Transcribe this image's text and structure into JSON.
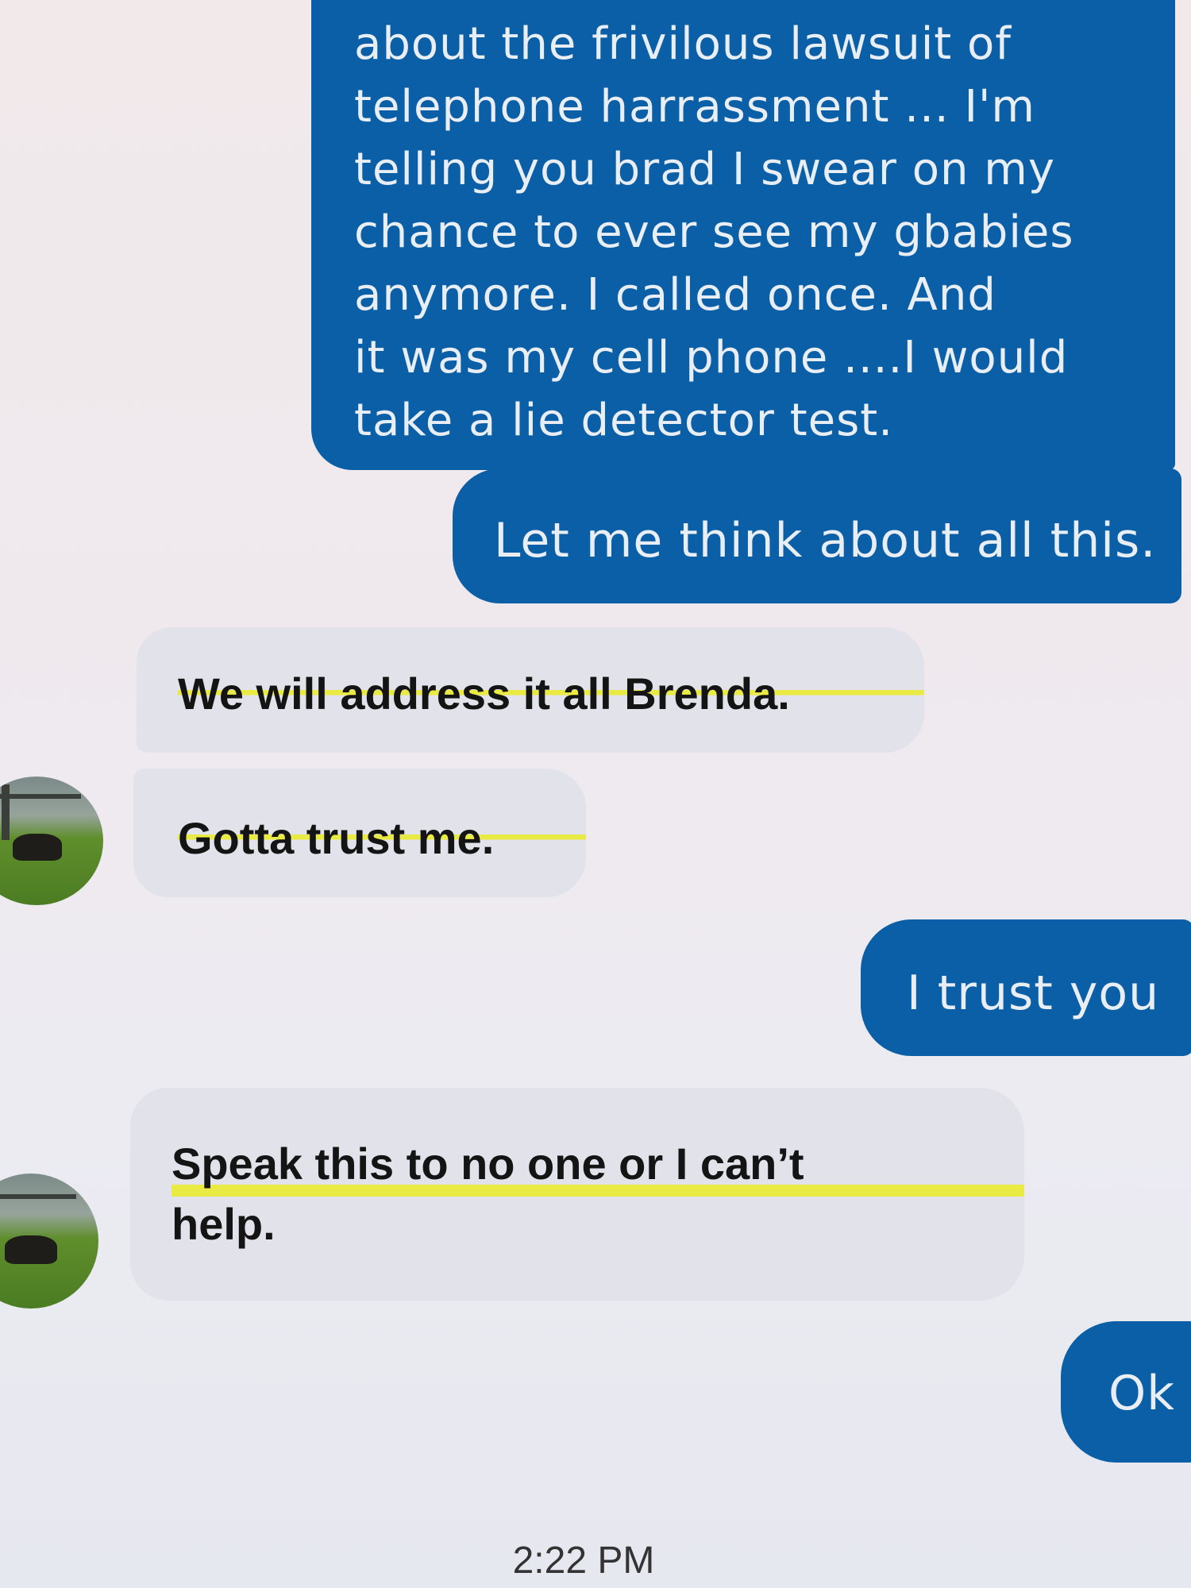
{
  "conversation": {
    "messages": [
      {
        "id": "m1",
        "direction": "sent",
        "text": "about the frivilous lawsuit of\ntelephone harrassment ...  I'm\ntelling you brad I swear on my\nchance to ever see my gbabies\nanymore.  I called once.  And\nit was my cell phone ....I would\ntake a lie detector test."
      },
      {
        "id": "m2",
        "direction": "sent",
        "text": "Let me think about all this."
      },
      {
        "id": "m3",
        "direction": "received",
        "text": "We will address it all Brenda."
      },
      {
        "id": "m4",
        "direction": "received",
        "text": "Gotta trust me."
      },
      {
        "id": "m5",
        "direction": "sent",
        "text": "I trust you"
      },
      {
        "id": "m6",
        "direction": "received",
        "text": "Speak this to no one or I can’t\nhelp."
      },
      {
        "id": "m7",
        "direction": "sent",
        "text": "Ok"
      }
    ],
    "timestamp": "2:22 PM"
  },
  "colors": {
    "sent_bubble": "#0a5fa6",
    "sent_text": "#e9eef5",
    "received_bubble": "#e2e2ea",
    "received_text": "#141414",
    "highlight": "#ecec28"
  }
}
